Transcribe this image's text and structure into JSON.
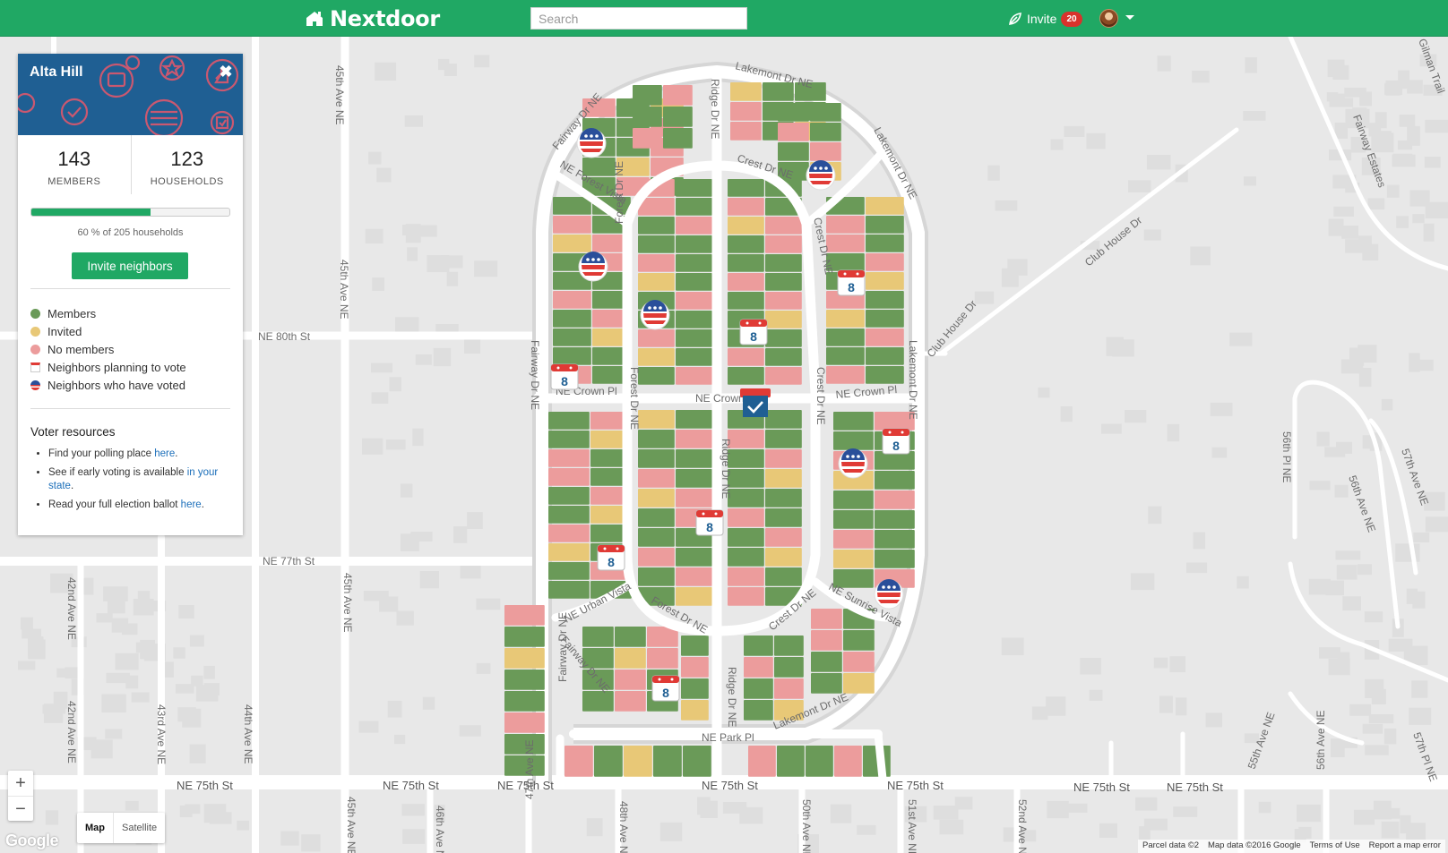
{
  "header": {
    "logo": "Nextdoor",
    "search_placeholder": "Search",
    "invite_label": "Invite",
    "invite_badge": "20"
  },
  "panel": {
    "title": "Alta Hill",
    "members_count": "143",
    "members_label": "MEMBERS",
    "households_count": "123",
    "households_label": "HOUSEHOLDS",
    "progress_percent": 60,
    "progress_text": "60 % of 205 households",
    "invite_button": "Invite neighbors",
    "legend": [
      {
        "label": "Members",
        "color": "#6a9a58"
      },
      {
        "label": "Invited",
        "color": "#e8c877"
      },
      {
        "label": "No members",
        "color": "#ec9c9c"
      },
      {
        "label": "Neighbors planning to vote",
        "icon": "calendar-icon"
      },
      {
        "label": "Neighbors who have voted",
        "icon": "voted-badge-icon"
      }
    ],
    "resources_title": "Voter resources",
    "resources": [
      {
        "text": "Find your polling place ",
        "link": "here",
        "after": "."
      },
      {
        "text": "See if early voting is available ",
        "link": "in your state",
        "after": "."
      },
      {
        "text": "Read your full election ballot ",
        "link": "here",
        "after": "."
      }
    ]
  },
  "map": {
    "streets": {
      "lakemont_top": "Lakemont Dr NE",
      "lakemont_side": "Lakemont Dr NE",
      "lakemont_right": "Lakemont Dr NE",
      "lakemont_bottom": "Lakemont Dr NE",
      "fairway_top": "Fairway Dr NE",
      "fairway_left": "Fairway Dr NE",
      "fairway_bottom": "Fairway Dr NE",
      "fairway_bottom2": "Fairway Dr NE",
      "ridge_top": "Ridge Dr NE",
      "ridge_mid": "Ridge Dr NE",
      "ridge_bottom": "Ridge Dr NE",
      "crest_top": "Crest Dr NE",
      "crest_side": "Crest Dr NE",
      "crest_mid": "Crest Dr NE",
      "crest_bottom": "Crest Dr NE",
      "forest_vista": "NE Forest Vista",
      "forest_dr1": "Forest Dr NE",
      "forest_dr2": "Forest Dr NE",
      "forest_dr3": "Forest Dr NE",
      "crown_left": "NE Crown Pl",
      "crown_mid": "NE Crown",
      "crown_right": "NE Crown Pl",
      "urban_vista": "NE Urban Vista",
      "sunrise_vista": "NE Sunrise Vista",
      "park_pl": "NE Park Pl",
      "club_house1": "Club House Dr",
      "club_house2": "Club House Dr",
      "fairway_estates": "Fairway Estates",
      "gilman": "Gilman Trail",
      "ne80": "NE 80th St",
      "ne77": "NE 77th St",
      "ne75_a": "NE 75th St",
      "ne75_b": "NE 75th St",
      "ne75_c": "NE 75th St",
      "ne75_d": "NE 75th St",
      "ne75_e": "NE 75th St",
      "ne75_f": "NE 75th St",
      "ne75_g": "NE 75th St",
      "ave42": "42nd Ave NE",
      "ave42b": "42nd Ave NE",
      "ave43": "43rd Ave NE",
      "ave44": "44th Ave NE",
      "ave44b": "44th Ave NE",
      "ave45a": "45th Ave NE",
      "ave45b": "45th Ave NE",
      "ave45c": "45th Ave NE",
      "ave45d": "45th Ave NE",
      "ave46": "46th Ave NE",
      "ave47": "47th Ave NE",
      "ave48": "48th Ave NE",
      "ave50": "50th Ave NE",
      "ave51": "51st Ave NE",
      "ave52": "52nd Ave NE",
      "ave55": "55th Ave NE",
      "ave56": "56th Ave NE",
      "ave56pl": "56th Pl NE",
      "ave57": "57th Ave NE",
      "ave57pl": "57th Pl NE",
      "ave56b": "56th Ave NE"
    },
    "calendar_number": "8",
    "zoom_in": "+",
    "zoom_out": "−",
    "map_type": [
      "Map",
      "Satellite"
    ],
    "google_logo": "Google",
    "attribution": [
      "Parcel data ©2",
      "Map data ©2016 Google",
      "Terms of Use",
      "Report a map error"
    ]
  },
  "colors": {
    "brand_green": "#20a864",
    "member": "#6a9a58",
    "invited": "#e8c877",
    "no_member": "#ec9c9c"
  }
}
